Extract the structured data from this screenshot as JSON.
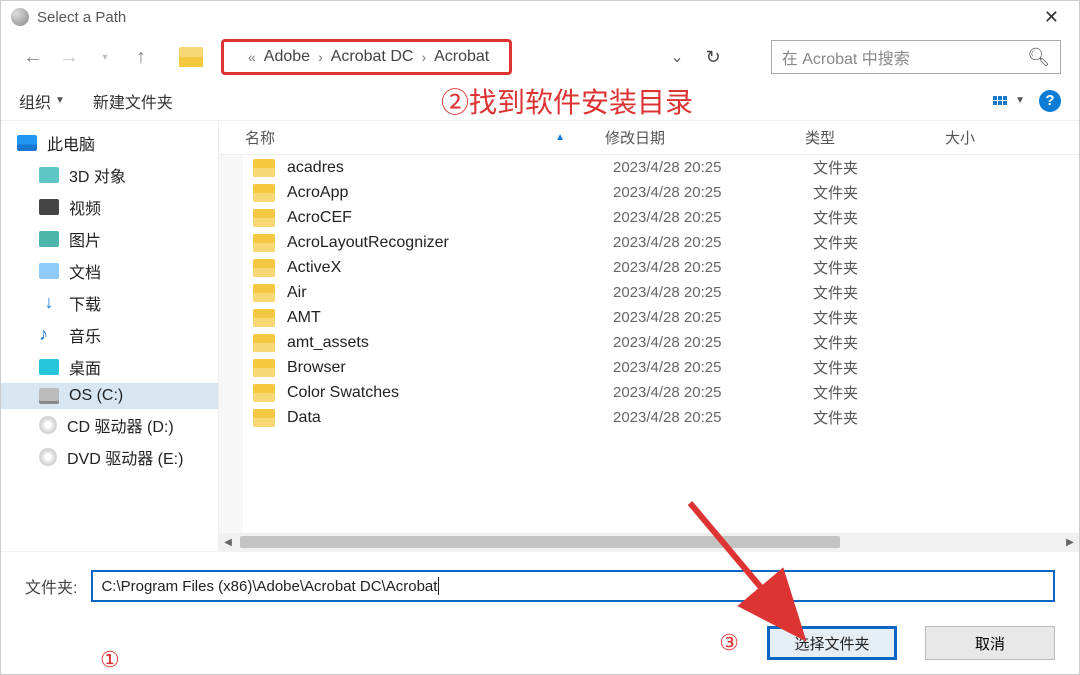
{
  "window": {
    "title": "Select a Path"
  },
  "nav": {
    "breadcrumbs": [
      "Adobe",
      "Acrobat DC",
      "Acrobat"
    ],
    "search_placeholder": "在 Acrobat 中搜索",
    "refresh_icon": "↻"
  },
  "toolbar": {
    "organize": "组织",
    "new_folder": "新建文件夹"
  },
  "annotations": {
    "a1": "①",
    "a2": "②找到软件安装目录",
    "a3": "③"
  },
  "sidebar": {
    "items": [
      {
        "label": "此电脑",
        "ico": "ico-pc"
      },
      {
        "label": "3D 对象",
        "ico": "ico-3d"
      },
      {
        "label": "视频",
        "ico": "ico-vid"
      },
      {
        "label": "图片",
        "ico": "ico-pic"
      },
      {
        "label": "文档",
        "ico": "ico-doc"
      },
      {
        "label": "下载",
        "ico": "ico-dl",
        "glyph": "↓"
      },
      {
        "label": "音乐",
        "ico": "ico-music",
        "glyph": "♪"
      },
      {
        "label": "桌面",
        "ico": "ico-desk"
      },
      {
        "label": "OS (C:)",
        "ico": "ico-drive",
        "selected": true
      },
      {
        "label": "CD 驱动器 (D:)",
        "ico": "ico-cd"
      },
      {
        "label": "DVD 驱动器 (E:)",
        "ico": "ico-cd"
      }
    ]
  },
  "columns": {
    "name": "名称",
    "date": "修改日期",
    "type": "类型",
    "size": "大小"
  },
  "files": [
    {
      "name": "acadres",
      "date": "2023/4/28 20:25",
      "type": "文件夹"
    },
    {
      "name": "AcroApp",
      "date": "2023/4/28 20:25",
      "type": "文件夹"
    },
    {
      "name": "AcroCEF",
      "date": "2023/4/28 20:25",
      "type": "文件夹"
    },
    {
      "name": "AcroLayoutRecognizer",
      "date": "2023/4/28 20:25",
      "type": "文件夹"
    },
    {
      "name": "ActiveX",
      "date": "2023/4/28 20:25",
      "type": "文件夹"
    },
    {
      "name": "Air",
      "date": "2023/4/28 20:25",
      "type": "文件夹"
    },
    {
      "name": "AMT",
      "date": "2023/4/28 20:25",
      "type": "文件夹"
    },
    {
      "name": "amt_assets",
      "date": "2023/4/28 20:25",
      "type": "文件夹"
    },
    {
      "name": "Browser",
      "date": "2023/4/28 20:25",
      "type": "文件夹"
    },
    {
      "name": "Color Swatches",
      "date": "2023/4/28 20:25",
      "type": "文件夹"
    },
    {
      "name": "Data",
      "date": "2023/4/28 20:25",
      "type": "文件夹"
    }
  ],
  "footer": {
    "path_label": "文件夹:",
    "path_value": "C:\\Program Files (x86)\\Adobe\\Acrobat DC\\Acrobat",
    "select_btn": "选择文件夹",
    "cancel_btn": "取消"
  }
}
